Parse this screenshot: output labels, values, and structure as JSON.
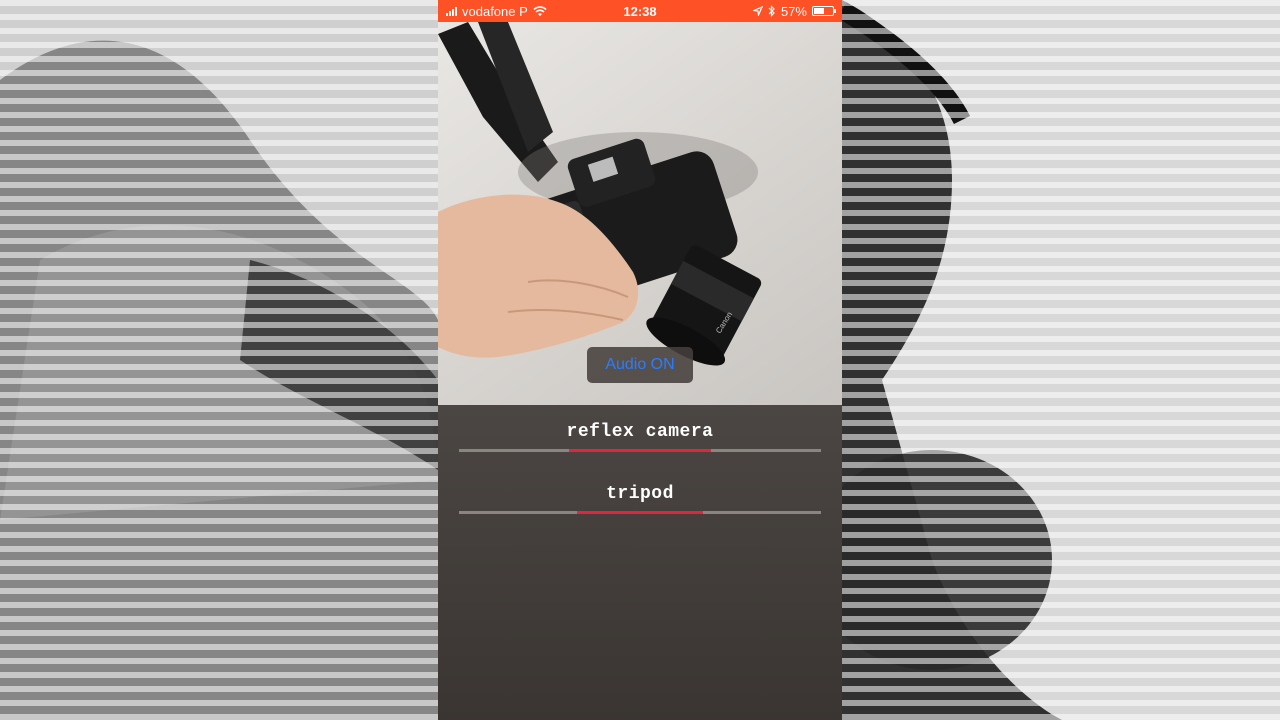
{
  "status_bar": {
    "carrier": "vodafone P",
    "time": "12:38",
    "battery": "57%",
    "battery_level": 0.57
  },
  "camera": {
    "audio_button": "Audio ON"
  },
  "predictions": [
    {
      "label": "reflex camera",
      "confidence": 0.39
    },
    {
      "label": "tripod",
      "confidence": 0.35
    }
  ],
  "colors": {
    "status_bar_bg": "#ff5126",
    "accent_bar": "#e0253f",
    "audio_text": "#2b7cff"
  },
  "icons": [
    "signal-icon",
    "wifi-icon",
    "location-icon",
    "bluetooth-icon",
    "battery-icon",
    "shutter-icon"
  ]
}
